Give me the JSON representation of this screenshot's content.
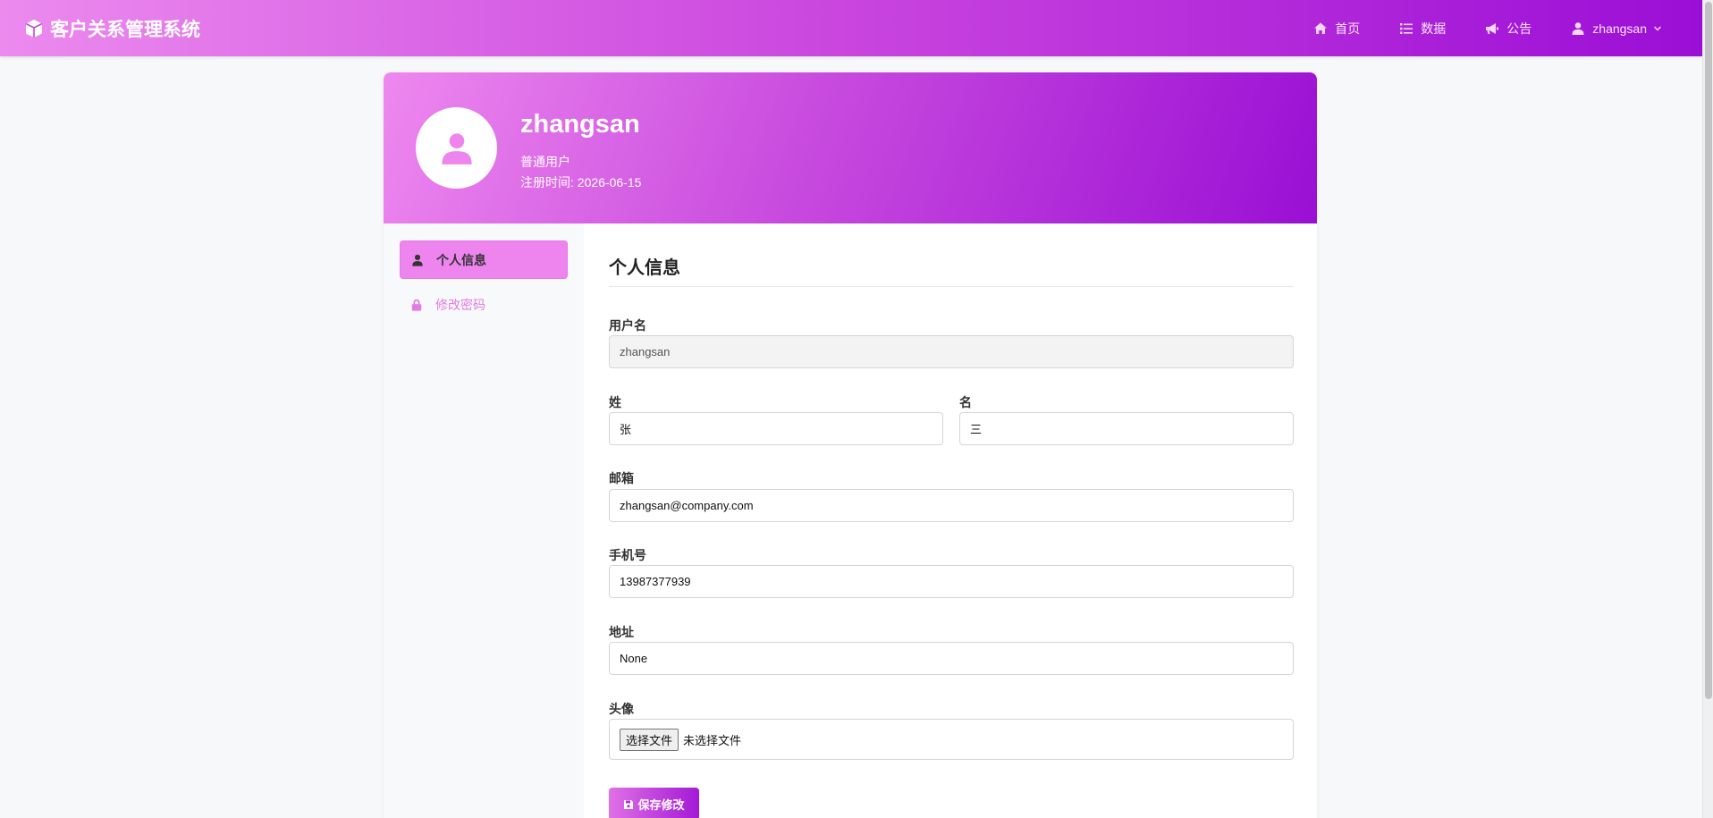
{
  "navbar": {
    "brand": "客户关系管理系统",
    "links": [
      {
        "label": "首页",
        "icon": "home-icon"
      },
      {
        "label": "数据",
        "icon": "list-icon"
      },
      {
        "label": "公告",
        "icon": "megaphone-icon"
      }
    ],
    "user": "zhangsan"
  },
  "profile": {
    "name": "zhangsan",
    "role": "普通用户",
    "registered": "注册时间: 2026-06-15"
  },
  "sidebar": {
    "items": [
      {
        "label": "个人信息",
        "icon": "user-icon",
        "active": true
      },
      {
        "label": "修改密码",
        "icon": "lock-icon",
        "active": false
      }
    ]
  },
  "form": {
    "title": "个人信息",
    "username_label": "用户名",
    "username_value": "zhangsan",
    "lastname_label": "姓",
    "lastname_value": "张",
    "firstname_label": "名",
    "firstname_value": "三",
    "email_label": "邮箱",
    "email_value": "zhangsan@company.com",
    "phone_label": "手机号",
    "phone_value": "13987377939",
    "address_label": "地址",
    "address_value": "None",
    "avatar_label": "头像",
    "file_button": "选择文件",
    "file_status": "未选择文件",
    "save_label": "保存修改"
  },
  "colors": {
    "accent_light": "#ee84ee",
    "accent_dark": "#9a0fd4"
  }
}
